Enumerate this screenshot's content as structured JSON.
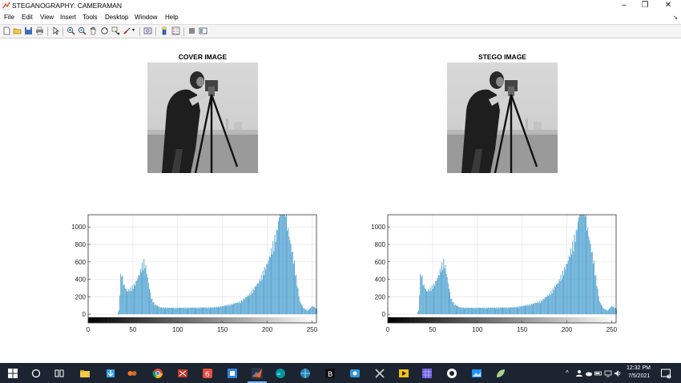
{
  "window": {
    "title": "STEGANOGRAPHY: CAMERAMAN",
    "minimize": "‒",
    "restore": "❐",
    "close": "✕"
  },
  "menu": [
    "File",
    "Edit",
    "View",
    "Insert",
    "Tools",
    "Desktop",
    "Window",
    "Help"
  ],
  "toolbar_icons": [
    "new-figure-icon",
    "open-file-icon",
    "save-icon",
    "print-icon",
    "pointer-icon",
    "zoom-in-icon",
    "zoom-out-icon",
    "pan-icon",
    "rotate-3d-icon",
    "data-cursor-icon",
    "brush-icon",
    "link-plot-icon",
    "insert-colorbar-icon",
    "insert-legend-icon",
    "hide-plot-tools-icon",
    "show-plot-tools-icon"
  ],
  "panels": {
    "cover_title": "COVER IMAGE",
    "stego_title": "STEGO IMAGE"
  },
  "chart_data": [
    {
      "type": "bar",
      "title": "",
      "xlabel": "",
      "ylabel": "",
      "xlim": [
        0,
        255
      ],
      "ylim": [
        -100,
        1140
      ],
      "xticks": [
        0,
        50,
        100,
        150,
        200,
        250
      ],
      "yticks": [
        0,
        200,
        400,
        600,
        800,
        1000
      ],
      "grid": true,
      "x_colorbar": "grayscale",
      "color": "#5aa7d3",
      "anchors": [
        [
          0,
          0
        ],
        [
          32,
          0
        ],
        [
          34,
          40
        ],
        [
          36,
          420
        ],
        [
          37,
          470
        ],
        [
          39,
          340
        ],
        [
          43,
          250
        ],
        [
          48,
          290
        ],
        [
          52,
          330
        ],
        [
          56,
          420
        ],
        [
          60,
          540
        ],
        [
          62,
          580
        ],
        [
          64,
          520
        ],
        [
          67,
          340
        ],
        [
          70,
          180
        ],
        [
          74,
          110
        ],
        [
          80,
          75
        ],
        [
          90,
          70
        ],
        [
          100,
          70
        ],
        [
          120,
          72
        ],
        [
          140,
          75
        ],
        [
          150,
          90
        ],
        [
          160,
          110
        ],
        [
          170,
          140
        ],
        [
          180,
          220
        ],
        [
          190,
          350
        ],
        [
          200,
          560
        ],
        [
          206,
          760
        ],
        [
          210,
          900
        ],
        [
          213,
          1060
        ],
        [
          215,
          1300
        ],
        [
          219,
          1320
        ],
        [
          222,
          980
        ],
        [
          226,
          760
        ],
        [
          230,
          560
        ],
        [
          233,
          340
        ],
        [
          236,
          140
        ],
        [
          240,
          70
        ],
        [
          245,
          40
        ],
        [
          250,
          90
        ],
        [
          255,
          60
        ]
      ]
    },
    {
      "type": "bar",
      "title": "",
      "xlabel": "",
      "ylabel": "",
      "xlim": [
        0,
        255
      ],
      "ylim": [
        -100,
        1140
      ],
      "xticks": [
        0,
        50,
        100,
        150,
        200,
        250
      ],
      "yticks": [
        0,
        200,
        400,
        600,
        800,
        1000
      ],
      "grid": true,
      "x_colorbar": "grayscale",
      "color": "#5aa7d3",
      "anchors": [
        [
          0,
          0
        ],
        [
          32,
          0
        ],
        [
          34,
          40
        ],
        [
          36,
          420
        ],
        [
          37,
          470
        ],
        [
          39,
          340
        ],
        [
          43,
          250
        ],
        [
          48,
          290
        ],
        [
          52,
          330
        ],
        [
          56,
          420
        ],
        [
          60,
          540
        ],
        [
          62,
          580
        ],
        [
          64,
          520
        ],
        [
          67,
          340
        ],
        [
          70,
          180
        ],
        [
          74,
          110
        ],
        [
          80,
          75
        ],
        [
          90,
          70
        ],
        [
          100,
          70
        ],
        [
          120,
          72
        ],
        [
          140,
          75
        ],
        [
          150,
          90
        ],
        [
          160,
          110
        ],
        [
          170,
          140
        ],
        [
          180,
          220
        ],
        [
          190,
          350
        ],
        [
          200,
          560
        ],
        [
          206,
          760
        ],
        [
          210,
          900
        ],
        [
          213,
          1060
        ],
        [
          215,
          1300
        ],
        [
          219,
          1320
        ],
        [
          222,
          980
        ],
        [
          226,
          760
        ],
        [
          230,
          560
        ],
        [
          233,
          340
        ],
        [
          236,
          140
        ],
        [
          240,
          70
        ],
        [
          245,
          40
        ],
        [
          250,
          90
        ],
        [
          255,
          60
        ]
      ]
    }
  ],
  "taskbar": {
    "time": "12:32 PM",
    "date": "7/5/2021",
    "tray_arrow": "^",
    "lang": "ENG"
  }
}
